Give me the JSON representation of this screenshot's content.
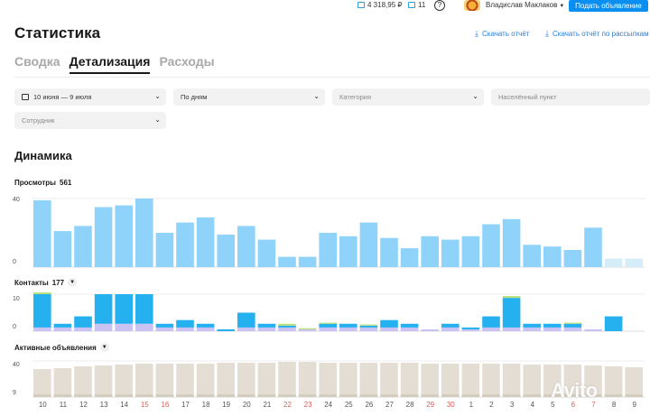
{
  "topbar": {
    "balance": "4 318,95 ₽",
    "messages": "11",
    "help": "?",
    "username": "Владислав Маклаков",
    "post_button": "Подать объявление"
  },
  "page": {
    "title": "Статистика",
    "download_report": "Скачать отчёт",
    "download_mailing": "Скачать отчёт по рассылкам"
  },
  "tabs": [
    "Сводка",
    "Детализация",
    "Расходы"
  ],
  "filters": {
    "period": "10 июня — 9 июля",
    "grouping": "По дням",
    "category": "Категория",
    "city": "Населённый пункт",
    "employee": "Сотрудник"
  },
  "dynamics": {
    "title": "Динамика",
    "views_label": "Просмотры",
    "views_total": "561",
    "contacts_label": "Контакты",
    "contacts_total": "177",
    "active_label": "Активные объявления"
  },
  "colors": {
    "views": "#8fd3fa",
    "views_dim": "#d5ecf9",
    "contacts": "#25b0f0",
    "contacts_secondary": "#c9c2f2",
    "contacts_tertiary": "#b9e07a",
    "active": "#e4ddd3",
    "active_dim": "#ede9e3",
    "weekend": "#e05a5a",
    "accent": "#0a8ff0"
  },
  "chart_data": [
    {
      "type": "bar",
      "name": "Просмотры",
      "ylim": [
        0,
        40
      ],
      "yticks": [
        "40",
        "0"
      ],
      "categories": [
        "10",
        "11",
        "12",
        "13",
        "14",
        "15",
        "16",
        "17",
        "18",
        "19",
        "20",
        "21",
        "22",
        "23",
        "24",
        "25",
        "26",
        "27",
        "28",
        "29",
        "30",
        "1",
        "2",
        "3",
        "4",
        "5",
        "6",
        "7",
        "8",
        "9"
      ],
      "values": [
        39,
        21,
        24,
        35,
        36,
        40,
        20,
        26,
        29,
        19,
        24,
        16,
        6,
        6,
        20,
        18,
        26,
        17,
        11,
        18,
        16,
        18,
        25,
        28,
        13,
        12,
        10,
        23,
        5,
        5
      ],
      "dimmed_from_index": 28
    },
    {
      "type": "bar",
      "name": "Контакты",
      "ylim": [
        0,
        10
      ],
      "yticks": [
        "10",
        "0"
      ],
      "series": [
        {
          "name": "primary",
          "values": [
            9,
            1,
            3,
            8,
            8,
            8,
            1,
            2,
            1,
            0.5,
            4,
            1,
            0.5,
            0,
            1,
            1,
            0.5,
            2,
            1,
            0,
            1,
            0.5,
            3,
            8,
            1,
            1,
            1,
            0,
            4,
            0
          ]
        },
        {
          "name": "secondary",
          "values": [
            1,
            1,
            1,
            2,
            2,
            2,
            1,
            1,
            1,
            0,
            1,
            1,
            1,
            0.5,
            1,
            1,
            1,
            1,
            1,
            0.5,
            1,
            0.5,
            1,
            1,
            1,
            1,
            1,
            0.5,
            0,
            0
          ]
        },
        {
          "name": "tertiary",
          "values": [
            0.5,
            0,
            0,
            0,
            0,
            0,
            0,
            0,
            0,
            0,
            0,
            0,
            0.5,
            0.3,
            0.3,
            0,
            0.3,
            0,
            0,
            0,
            0,
            0,
            0,
            0.5,
            0,
            0,
            0.3,
            0,
            0,
            0
          ]
        }
      ]
    },
    {
      "type": "bar",
      "name": "Активные объявления",
      "ylim": [
        0,
        40
      ],
      "yticks": [
        "40",
        "9"
      ],
      "values": [
        31,
        32,
        34,
        35,
        36,
        37,
        37,
        37,
        37,
        38,
        38,
        38,
        39,
        39,
        38,
        38,
        38,
        38,
        38,
        37,
        37,
        37,
        37,
        37,
        36,
        36,
        36,
        35,
        34,
        33
      ]
    }
  ],
  "x_axis": {
    "ticks": [
      "10",
      "11",
      "12",
      "13",
      "14",
      "15",
      "16",
      "17",
      "18",
      "19",
      "20",
      "21",
      "22",
      "23",
      "24",
      "25",
      "26",
      "27",
      "28",
      "29",
      "30",
      "1",
      "2",
      "3",
      "4",
      "5",
      "6",
      "7",
      "8",
      "9"
    ],
    "weekend_indices": [
      5,
      6,
      12,
      13,
      19,
      20,
      26,
      27
    ]
  },
  "watermark": "Avito"
}
